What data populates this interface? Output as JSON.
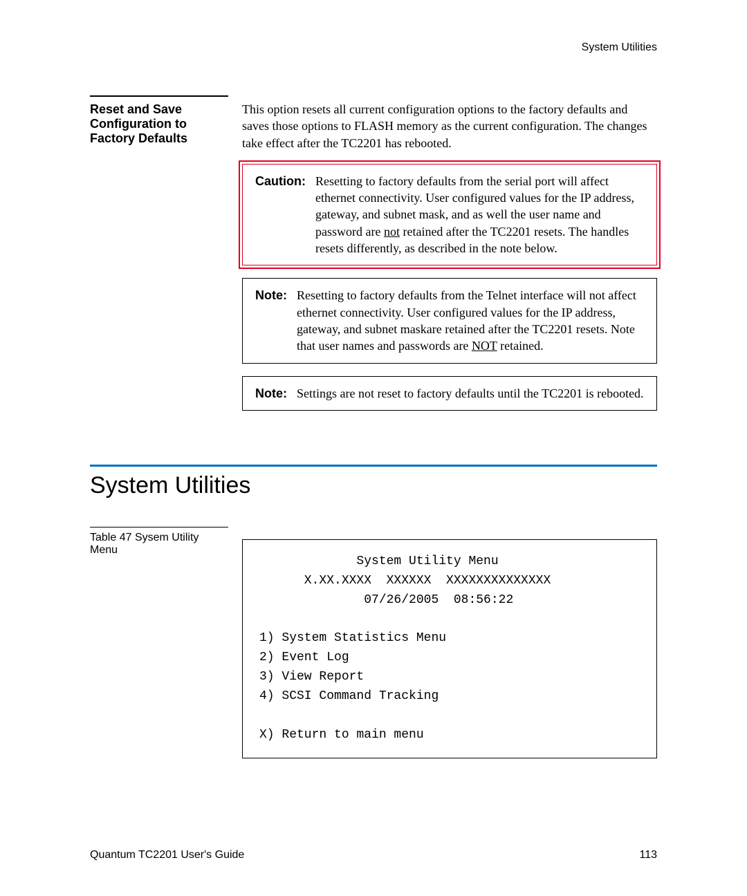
{
  "header": {
    "right": "System Utilities"
  },
  "reset_section": {
    "heading": "Reset and Save Configuration to Factory Defaults",
    "body": "This option resets all current configuration options to the factory defaults and saves those options to FLASH memory as the current configuration. The changes take effect after the TC2201 has rebooted.",
    "caution": {
      "label": "Caution:",
      "pre": "Resetting to factory defaults from the serial port will affect ethernet connectivity. User configured values for the IP address, gateway, and subnet mask, and as well the user name and password are ",
      "u": "not",
      "post": " retained after the TC2201 resets. The handles resets differently, as described in the note below."
    },
    "note1": {
      "label": "Note:",
      "pre": "Resetting to factory defaults from the Telnet interface will not affect ethernet connectivity. User configured values for the IP address, gateway, and subnet maskare retained after the TC2201 resets. Note that user names and passwords are ",
      "u": "NOT",
      "post": " retained."
    },
    "note2": {
      "label": "Note:",
      "text": "Settings are not reset to factory defaults until the TC2201 is rebooted."
    }
  },
  "main_heading": "System Utilities",
  "table": {
    "caption": "Table 47  Sysem Utility Menu",
    "menu_text": "             System Utility Menu\n      X.XX.XXXX  XXXXXX  XXXXXXXXXXXXXX\n              07/26/2005  08:56:22\n\n1) System Statistics Menu\n2) Event Log\n3) View Report\n4) SCSI Command Tracking\n\nX) Return to main menu"
  },
  "footer": {
    "left": "Quantum TC2201 User's Guide",
    "right": "113"
  }
}
